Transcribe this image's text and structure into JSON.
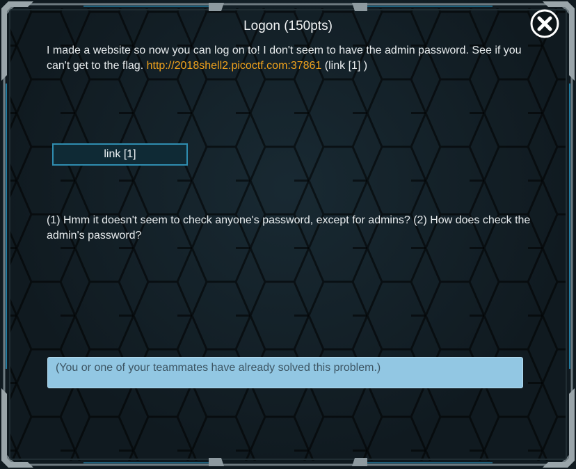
{
  "dialog": {
    "title": "Logon (150pts)",
    "description_text": "I made a website so now you can log on to! I don't seem to have the admin password. See if you can't get to the flag.",
    "description_url": "http://2018shell2.picoctf.com:37861",
    "description_suffix": "(link [1] )",
    "link_button_label": "link [1]",
    "hints_text": "(1) Hmm it doesn't seem to check anyone's password, except for admins? (2) How does check the admin's password?",
    "solved_message": "(You or one of your teammates have already solved this problem.)",
    "close_icon": "close-circle-icon"
  },
  "colors": {
    "background": "#101a20",
    "link": "#f0a21c",
    "button_border": "#2f8db0",
    "banner_bg": "#92c7e3",
    "frame_accent": "#2aa4d6"
  }
}
